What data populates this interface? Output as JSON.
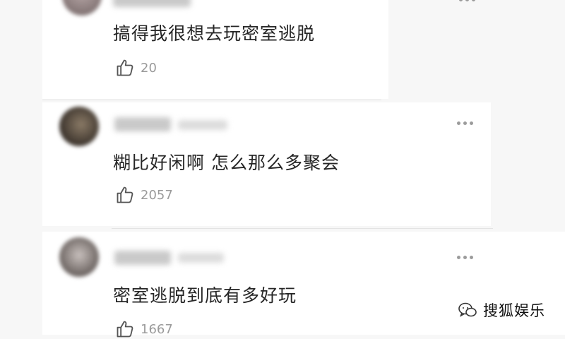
{
  "comments": [
    {
      "text": "搞得我很想去玩密室逃脱",
      "likes": "20"
    },
    {
      "text": "糊比好闲啊 怎么那么多聚会",
      "likes": "2057"
    },
    {
      "text": "密室逃脱到底有多好玩",
      "likes": "1667"
    }
  ],
  "icons": {
    "like": "thumbs-up-icon",
    "more": "more-dots-icon",
    "logo": "wechat-icon"
  },
  "watermark": {
    "text": "搜狐娱乐"
  }
}
